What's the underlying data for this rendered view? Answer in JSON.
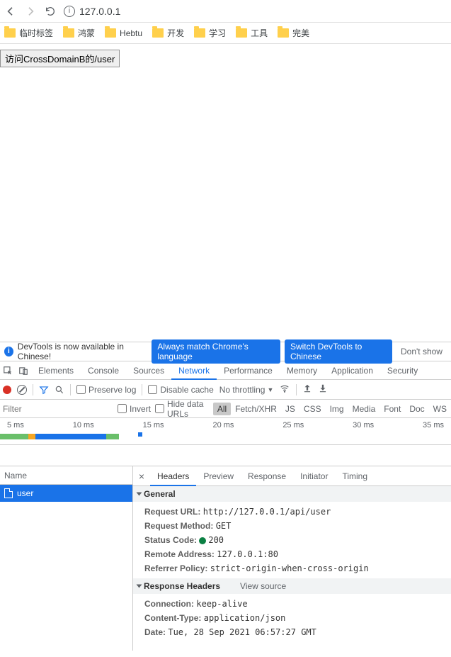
{
  "navbar": {
    "url": "127.0.0.1"
  },
  "bookmarks": [
    "临时标签",
    "鸿蒙",
    "Hebtu",
    "开发",
    "学习",
    "工具",
    "完美"
  ],
  "page": {
    "button_label": "访问CrossDomainB的/user"
  },
  "banner": {
    "msg": "DevTools is now available in Chinese!",
    "btn1": "Always match Chrome's language",
    "btn2": "Switch DevTools to Chinese",
    "btn3": "Don't show"
  },
  "dt_tabs": [
    "Elements",
    "Console",
    "Sources",
    "Network",
    "Performance",
    "Memory",
    "Application",
    "Security"
  ],
  "net_toolbar": {
    "preserve": "Preserve log",
    "disable_cache": "Disable cache",
    "throttling": "No throttling"
  },
  "filter_row": {
    "filter_placeholder": "Filter",
    "invert": "Invert",
    "hide_urls": "Hide data URLs",
    "types": [
      "All",
      "Fetch/XHR",
      "JS",
      "CSS",
      "Img",
      "Media",
      "Font",
      "Doc",
      "WS"
    ]
  },
  "timeline_ticks": [
    "5 ms",
    "10 ms",
    "15 ms",
    "20 ms",
    "25 ms",
    "30 ms",
    "35 ms"
  ],
  "reqlist": {
    "header": "Name",
    "items": [
      "user"
    ]
  },
  "detail_tabs": [
    "Headers",
    "Preview",
    "Response",
    "Initiator",
    "Timing"
  ],
  "general": {
    "title": "General",
    "rows": [
      {
        "k": "Request URL:",
        "v": "http://127.0.0.1/api/user"
      },
      {
        "k": "Request Method:",
        "v": "GET"
      },
      {
        "k": "Status Code:",
        "v": "200",
        "dot": true
      },
      {
        "k": "Remote Address:",
        "v": "127.0.0.1:80"
      },
      {
        "k": "Referrer Policy:",
        "v": "strict-origin-when-cross-origin"
      }
    ]
  },
  "response_headers": {
    "title": "Response Headers",
    "view_source": "View source",
    "rows": [
      {
        "k": "Connection:",
        "v": "keep-alive"
      },
      {
        "k": "Content-Type:",
        "v": "application/json"
      },
      {
        "k": "Date:",
        "v": "Tue, 28 Sep 2021 06:57:27 GMT"
      }
    ]
  }
}
